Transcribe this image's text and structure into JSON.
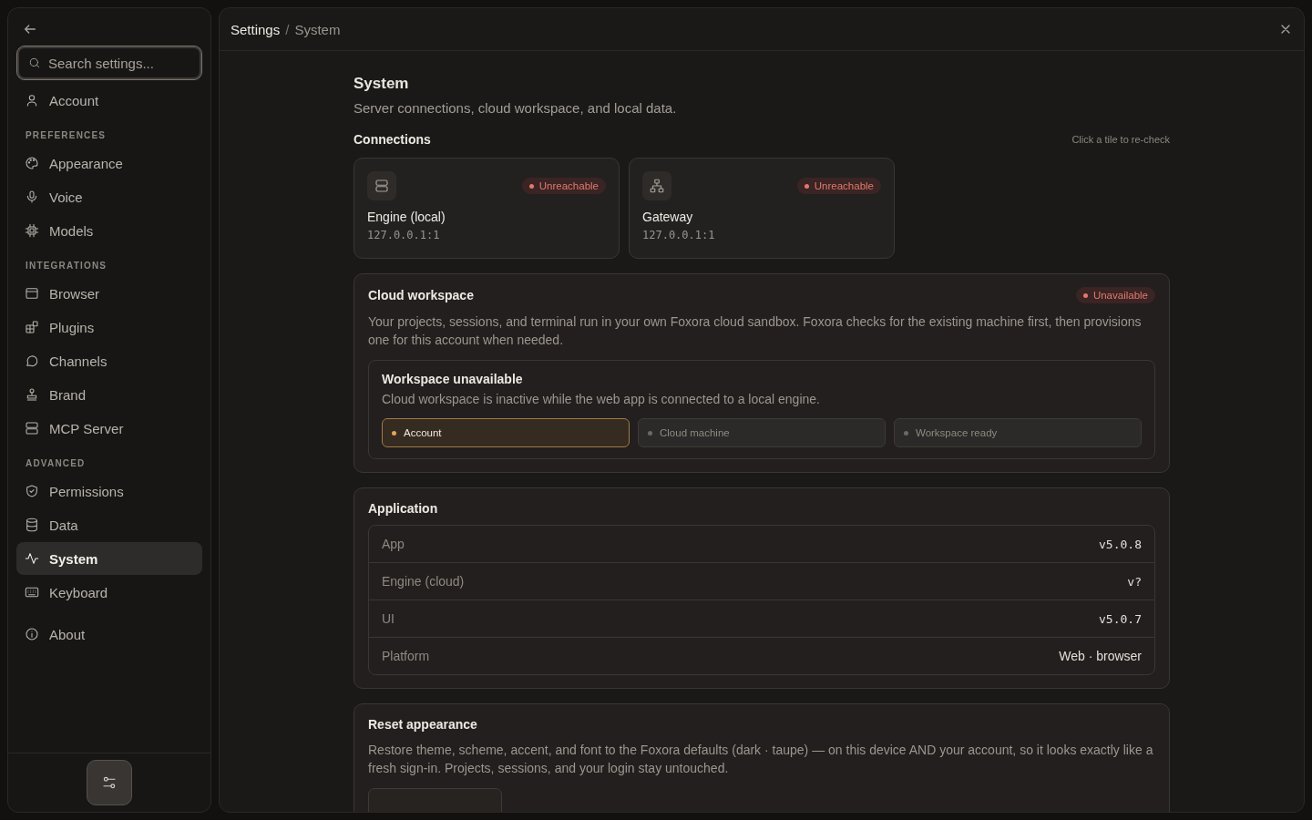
{
  "sidebar": {
    "search": {
      "placeholder": "Search settings..."
    },
    "groups": [
      {
        "items": [
          {
            "label": "Account",
            "selected": false
          }
        ]
      },
      {
        "heading": "PREFERENCES",
        "items": [
          {
            "label": "Appearance",
            "selected": false
          },
          {
            "label": "Voice",
            "selected": false
          },
          {
            "label": "Models",
            "selected": false
          }
        ]
      },
      {
        "heading": "INTEGRATIONS",
        "items": [
          {
            "label": "Browser",
            "selected": false
          },
          {
            "label": "Plugins",
            "selected": false
          },
          {
            "label": "Channels",
            "selected": false
          },
          {
            "label": "Brand",
            "selected": false
          },
          {
            "label": "MCP Server",
            "selected": false
          }
        ]
      },
      {
        "heading": "ADVANCED",
        "items": [
          {
            "label": "Permissions",
            "selected": false
          },
          {
            "label": "Data",
            "selected": false
          },
          {
            "label": "System",
            "selected": true
          },
          {
            "label": "Keyboard",
            "selected": false
          }
        ]
      },
      {
        "items": [
          {
            "label": "About",
            "selected": false
          }
        ]
      }
    ]
  },
  "breadcrumb": {
    "parent": "Settings",
    "separator": "/",
    "current": "System"
  },
  "page": {
    "title": "System",
    "subtitle": "Server connections, cloud workspace, and local data."
  },
  "connections": {
    "title": "Connections",
    "hint": "Click a tile to re-check",
    "tiles": [
      {
        "name": "Engine (local)",
        "address": "127.0.0.1:1",
        "status": "Unreachable"
      },
      {
        "name": "Gateway",
        "address": "127.0.0.1:1",
        "status": "Unreachable"
      }
    ]
  },
  "cloud": {
    "title": "Cloud workspace",
    "status": "Unavailable",
    "description": "Your projects, sessions, and terminal run in your own Foxora cloud sandbox. Foxora checks for the existing machine first, then provisions one for this account when needed.",
    "notice": {
      "title": "Workspace unavailable",
      "text": "Cloud workspace is inactive while the web app is connected to a local engine."
    },
    "steps": [
      {
        "label": "Account",
        "active": true
      },
      {
        "label": "Cloud machine",
        "active": false
      },
      {
        "label": "Workspace ready",
        "active": false
      }
    ]
  },
  "application": {
    "title": "Application",
    "rows": [
      {
        "label": "App",
        "value": "v5.0.8",
        "kind": "mono"
      },
      {
        "label": "Engine (cloud)",
        "value": "v?",
        "kind": "mono"
      },
      {
        "label": "UI",
        "value": "v5.0.7",
        "kind": "mono"
      },
      {
        "label": "Platform",
        "value": "Web · browser",
        "kind": "text"
      }
    ]
  },
  "reset": {
    "title": "Reset appearance",
    "description": "Restore theme, scheme, accent, and font to the Foxora defaults (dark · taupe) — on this device AND your account, so it looks exactly like a fresh sign-in. Projects, sessions, and your login stay untouched."
  }
}
